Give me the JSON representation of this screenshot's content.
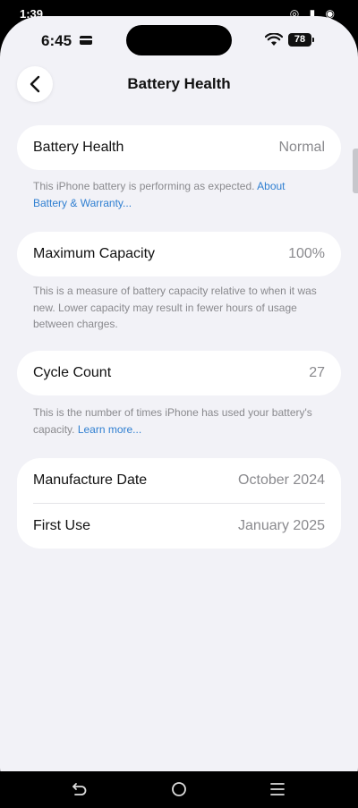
{
  "outer_status": {
    "time": "1:39"
  },
  "ios_status": {
    "time": "6:45",
    "battery_level": "78"
  },
  "nav": {
    "title": "Battery Health"
  },
  "battery_health": {
    "label": "Battery Health",
    "value": "Normal",
    "note": "This iPhone battery is performing as expected.",
    "link": "About Battery & Warranty..."
  },
  "max_capacity": {
    "label": "Maximum Capacity",
    "value": "100%",
    "note": "This is a measure of battery capacity relative to when it was new. Lower capacity may result in fewer hours of usage between charges."
  },
  "cycle_count": {
    "label": "Cycle Count",
    "value": "27",
    "note": "This is the number of times iPhone has used your battery's capacity.",
    "link": "Learn more..."
  },
  "dates": {
    "manufacture_label": "Manufacture Date",
    "manufacture_value": "October 2024",
    "first_use_label": "First Use",
    "first_use_value": "January 2025"
  },
  "colors": {
    "accent": "#2f7fd1",
    "background": "#f2f2f7"
  }
}
